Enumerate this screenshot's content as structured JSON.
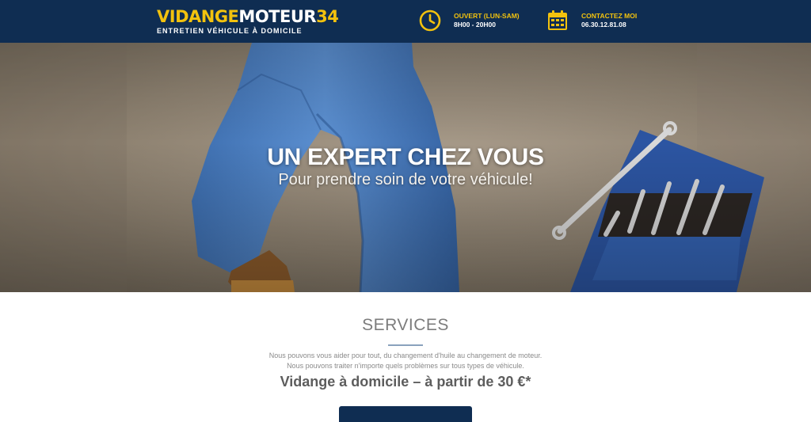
{
  "header": {
    "logo_part1": "VIDANGE",
    "logo_part2": "MOTEUR",
    "logo_part3": "34",
    "tagline": "ENTRETIEN VÉHICULE À DOMICILE",
    "hours_title": "OUVERT (LUN-SAM)",
    "hours_value": "8H00 - 20H00",
    "contact_title": "CONTACTEZ MOI",
    "contact_value": "06.30.12.81.08",
    "hours_icon": "clock-icon",
    "contact_icon": "calendar-icon"
  },
  "hero": {
    "title": "UN EXPERT CHEZ VOUS",
    "subtitle": "Pour prendre soin de votre véhicule!"
  },
  "services": {
    "title": "SERVICES",
    "line1": "Nous pouvons vous aider pour tout, du changement d'huile au changement de moteur.",
    "line2": "Nous pouvons traiter n'importe quels problèmes sur tous types de véhicule.",
    "price": "Vidange à domicile – à partir de 30 €*"
  },
  "colors": {
    "navy": "#0f2d52",
    "accent_yellow": "#f2c20e"
  }
}
